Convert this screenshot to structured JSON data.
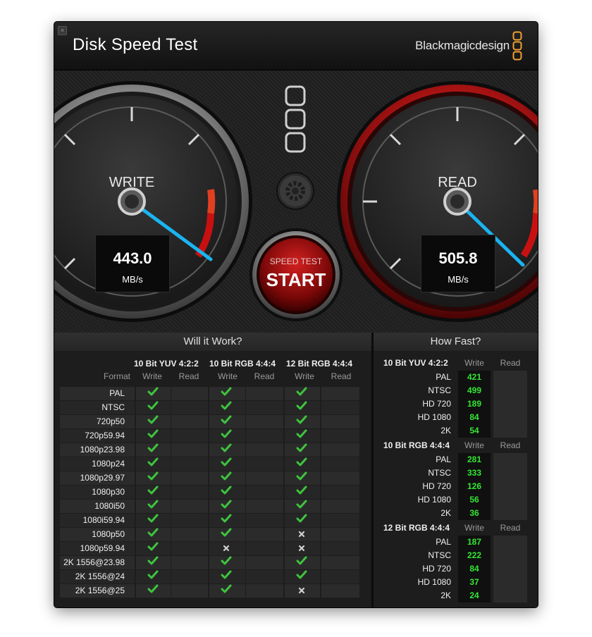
{
  "window": {
    "title": "Disk Speed Test",
    "brand": "Blackmagicdesign",
    "close_icon": "close-icon"
  },
  "gauges": {
    "write": {
      "label": "WRITE",
      "value": "443.0",
      "unit": "MB/s",
      "needle_fraction": 0.7
    },
    "read": {
      "label": "READ",
      "value": "505.8",
      "unit": "MB/s",
      "needle_fraction": 0.73
    }
  },
  "controls": {
    "start_small": "SPEED TEST",
    "start_big": "START",
    "settings_icon": "gear-icon"
  },
  "colors": {
    "accent_red": "#c01818",
    "needle_blue": "#1ab4f0",
    "check_green": "#3ec43e",
    "value_green": "#33e633",
    "brand_orange": "#f0a030"
  },
  "will_it_work": {
    "title": "Will it Work?",
    "format_label": "Format",
    "write_label": "Write",
    "read_label": "Read",
    "groups": [
      "10 Bit YUV 4:2:2",
      "10 Bit RGB 4:4:4",
      "12 Bit RGB 4:4:4"
    ],
    "rows": [
      {
        "format": "PAL",
        "w": [
          true,
          true,
          true
        ]
      },
      {
        "format": "NTSC",
        "w": [
          true,
          true,
          true
        ]
      },
      {
        "format": "720p50",
        "w": [
          true,
          true,
          true
        ]
      },
      {
        "format": "720p59.94",
        "w": [
          true,
          true,
          true
        ]
      },
      {
        "format": "1080p23.98",
        "w": [
          true,
          true,
          true
        ]
      },
      {
        "format": "1080p24",
        "w": [
          true,
          true,
          true
        ]
      },
      {
        "format": "1080p29.97",
        "w": [
          true,
          true,
          true
        ]
      },
      {
        "format": "1080p30",
        "w": [
          true,
          true,
          true
        ]
      },
      {
        "format": "1080i50",
        "w": [
          true,
          true,
          true
        ]
      },
      {
        "format": "1080i59.94",
        "w": [
          true,
          true,
          true
        ]
      },
      {
        "format": "1080p50",
        "w": [
          true,
          true,
          false
        ]
      },
      {
        "format": "1080p59.94",
        "w": [
          true,
          false,
          false
        ]
      },
      {
        "format": "2K 1556@23.98",
        "w": [
          true,
          true,
          true
        ]
      },
      {
        "format": "2K 1556@24",
        "w": [
          true,
          true,
          true
        ]
      },
      {
        "format": "2K 1556@25",
        "w": [
          true,
          true,
          false
        ]
      }
    ]
  },
  "how_fast": {
    "title": "How Fast?",
    "write_label": "Write",
    "read_label": "Read",
    "groups": [
      {
        "name": "10 Bit YUV 4:2:2",
        "rows": [
          {
            "format": "PAL",
            "write": "421"
          },
          {
            "format": "NTSC",
            "write": "499"
          },
          {
            "format": "HD 720",
            "write": "189"
          },
          {
            "format": "HD 1080",
            "write": "84"
          },
          {
            "format": "2K",
            "write": "54"
          }
        ]
      },
      {
        "name": "10 Bit RGB 4:4:4",
        "rows": [
          {
            "format": "PAL",
            "write": "281"
          },
          {
            "format": "NTSC",
            "write": "333"
          },
          {
            "format": "HD 720",
            "write": "126"
          },
          {
            "format": "HD 1080",
            "write": "56"
          },
          {
            "format": "2K",
            "write": "36"
          }
        ]
      },
      {
        "name": "12 Bit RGB 4:4:4",
        "rows": [
          {
            "format": "PAL",
            "write": "187"
          },
          {
            "format": "NTSC",
            "write": "222"
          },
          {
            "format": "HD 720",
            "write": "84"
          },
          {
            "format": "HD 1080",
            "write": "37"
          },
          {
            "format": "2K",
            "write": "24"
          }
        ]
      }
    ]
  }
}
